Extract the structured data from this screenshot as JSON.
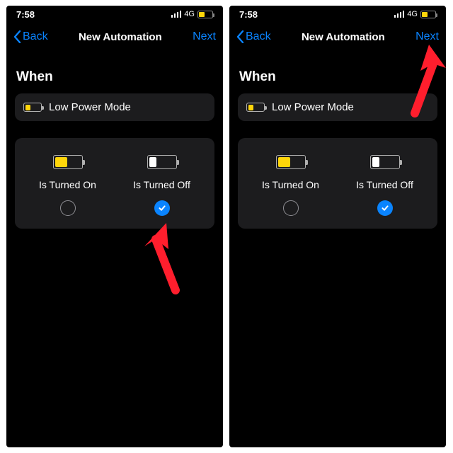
{
  "left": {
    "status": {
      "time": "7:58",
      "network": "4G"
    },
    "nav": {
      "back": "Back",
      "title": "New Automation",
      "next": "Next"
    },
    "section": "When",
    "trigger": "Low Power Mode",
    "options": {
      "on": {
        "label": "Is Turned On",
        "selected": false
      },
      "off": {
        "label": "Is Turned Off",
        "selected": true
      }
    }
  },
  "right": {
    "status": {
      "time": "7:58",
      "network": "4G"
    },
    "nav": {
      "back": "Back",
      "title": "New Automation",
      "next": "Next"
    },
    "section": "When",
    "trigger": "Low Power Mode",
    "options": {
      "on": {
        "label": "Is Turned On",
        "selected": false
      },
      "off": {
        "label": "Is Turned Off",
        "selected": true
      }
    }
  },
  "colors": {
    "accent": "#0a84ff",
    "low_power": "#ffd60a",
    "annotation": "#ff1e2d",
    "card": "#1c1c1e"
  }
}
